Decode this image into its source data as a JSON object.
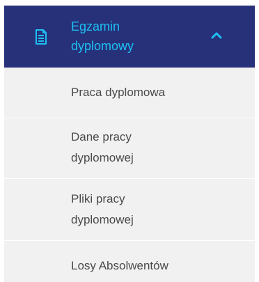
{
  "menu": {
    "header": {
      "label": "Egzamin\ndyplomowy",
      "icon": "document-icon",
      "chevron": "chevron-up-icon",
      "background_color": "#26317a",
      "text_color": "#1ec0f2"
    },
    "items": [
      {
        "label": "Praca dyplomowa"
      },
      {
        "label": "Dane pracy\ndyplomowej"
      },
      {
        "label": "Pliki pracy\ndyplomowej"
      },
      {
        "label": "Losy Absolwentów"
      }
    ]
  }
}
